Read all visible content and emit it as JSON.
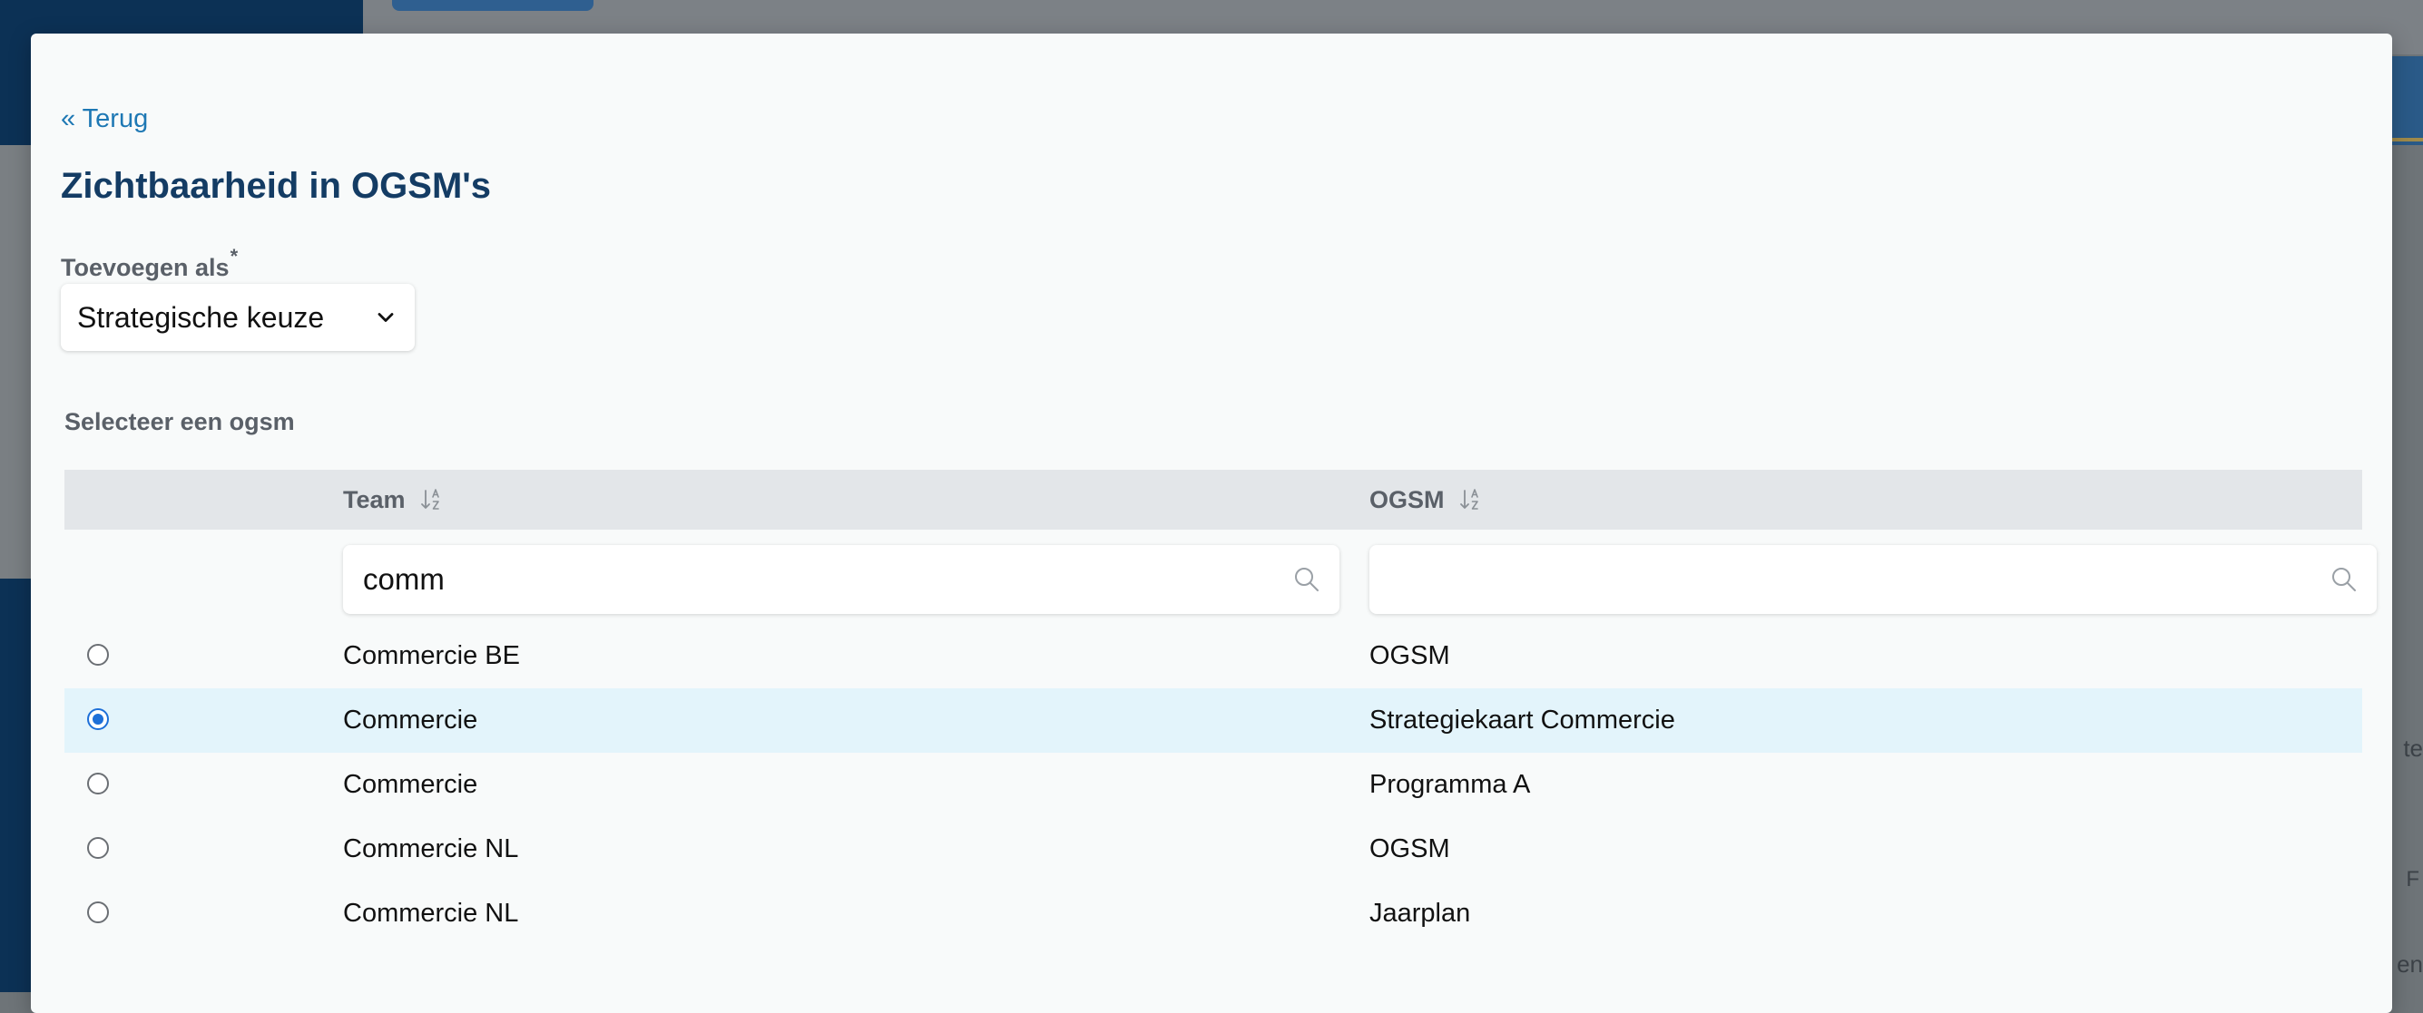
{
  "background": {
    "right_text_1": "te",
    "right_text_2": "F",
    "right_text_3": "en"
  },
  "modal": {
    "back_label": "« Terug",
    "title": "Zichtbaarheid in OGSM's",
    "add_as_label": "Toevoegen als",
    "required_mark": "*",
    "add_as_value": "Strategische keuze",
    "select_ogsm_label": "Selecteer een ogsm"
  },
  "table": {
    "columns": {
      "team": "Team",
      "ogsm": "OGSM"
    },
    "filters": {
      "team_value": "comm",
      "ogsm_value": ""
    },
    "rows": [
      {
        "team": "Commercie BE",
        "ogsm": "OGSM",
        "selected": false
      },
      {
        "team": "Commercie",
        "ogsm": "Strategiekaart Commercie",
        "selected": true
      },
      {
        "team": "Commercie",
        "ogsm": "Programma A",
        "selected": false
      },
      {
        "team": "Commercie NL",
        "ogsm": "OGSM",
        "selected": false
      },
      {
        "team": "Commercie NL",
        "ogsm": "Jaarplan",
        "selected": false
      }
    ]
  },
  "colors": {
    "accent": "#1d6fd8",
    "link": "#1e78b4",
    "title": "#143c64",
    "selected_row": "#e3f4fb"
  }
}
